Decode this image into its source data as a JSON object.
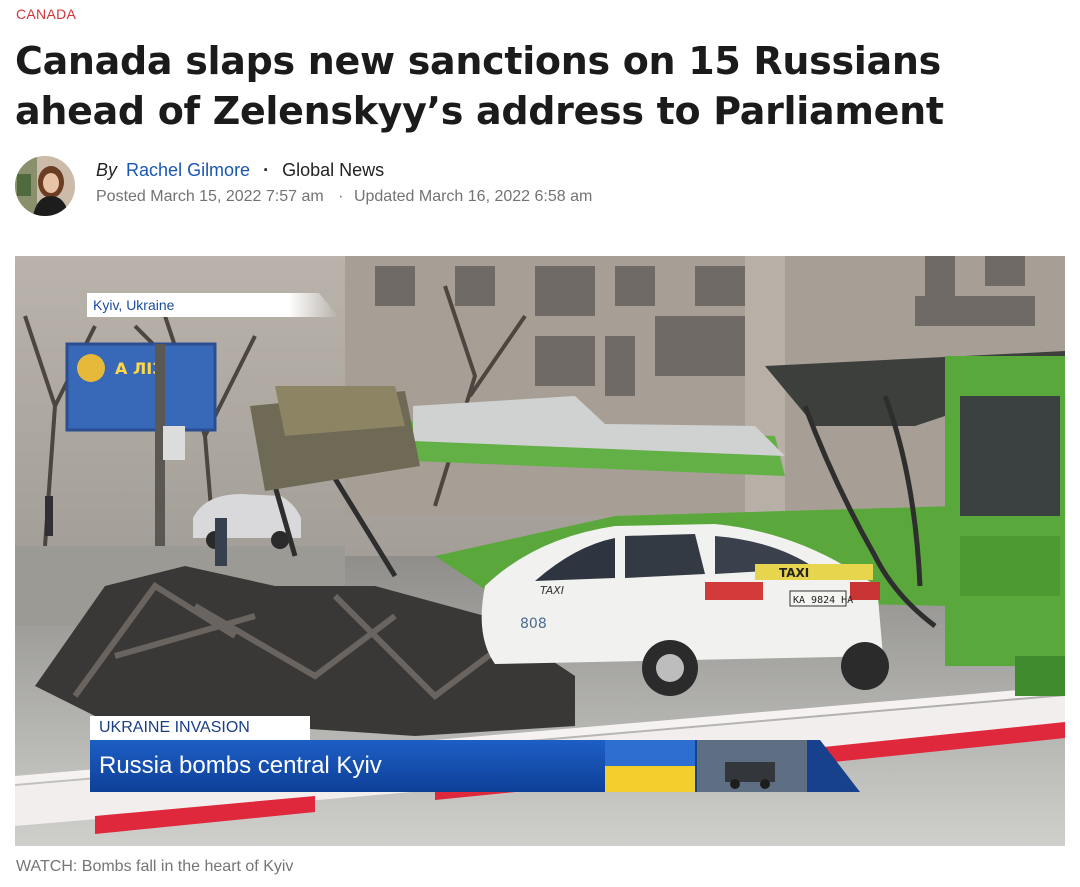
{
  "section": "CANADA",
  "headline": "Canada slaps new sanctions on 15 Russians ahead of Zelenskyy’s address to Parliament",
  "byline": {
    "by": "By",
    "author": "Rachel Gilmore",
    "separator": "·",
    "outlet": "Global News"
  },
  "dates": {
    "posted": "Posted March 15, 2022 7:57 am",
    "separator": "·",
    "updated": "Updated March 16, 2022 6:58 am"
  },
  "hero": {
    "location_tag": "Kyiv, Ukraine",
    "kicker": "UKRAINE INVASION",
    "chyron": "Russia bombs central Kyiv",
    "billboard_text": "А ЛІЗ",
    "taxi_roof": "TAXI",
    "taxi_door": "TAXI",
    "taxi_number": "808",
    "license_plate": "КА 9824 НА"
  },
  "caption": "WATCH: Bombs fall in the heart of Kyiv",
  "colors": {
    "section_red": "#d1343a",
    "author_blue": "#1a56b3",
    "chyron_blue": "#1d5fc5",
    "police_tape_red": "#e0283c",
    "trolleybus_green": "#5aa83c"
  }
}
